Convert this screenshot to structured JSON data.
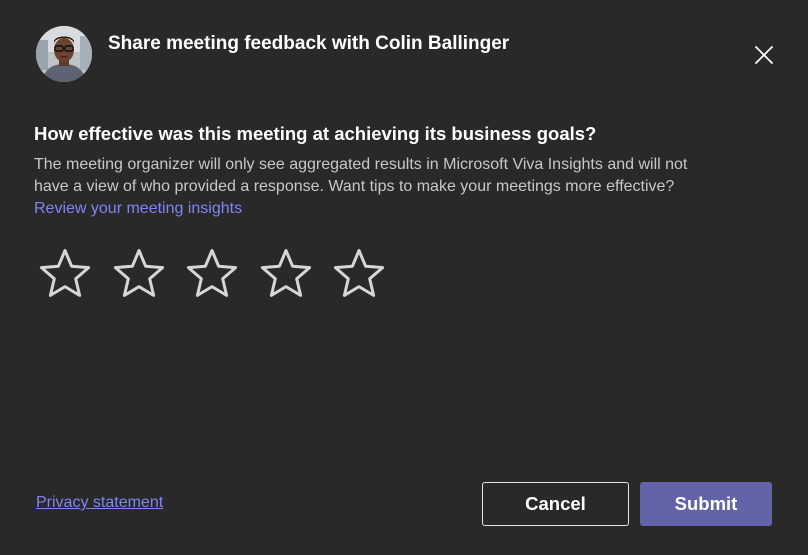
{
  "header": {
    "title": "Share meeting feedback with Colin Ballinger",
    "avatar_alt": "Colin Ballinger"
  },
  "close_icon": "close-icon",
  "question": "How effective was this meeting at achieving its business goals?",
  "description": {
    "line1": "The meeting organizer will only see aggregated results in Microsoft Viva Insights and will not",
    "line2": "have a view of who provided a response. Want tips to make your meetings more effective?"
  },
  "insights_link": "Review your meeting insights",
  "rating": {
    "max": 5,
    "value": 0,
    "icon": "star-outline-icon"
  },
  "footer": {
    "privacy_link": "Privacy statement",
    "cancel_label": "Cancel",
    "submit_label": "Submit"
  },
  "colors": {
    "background": "#292929",
    "link": "#7f85f5",
    "accent": "#6264a7",
    "star_stroke": "#d6d6d6"
  }
}
